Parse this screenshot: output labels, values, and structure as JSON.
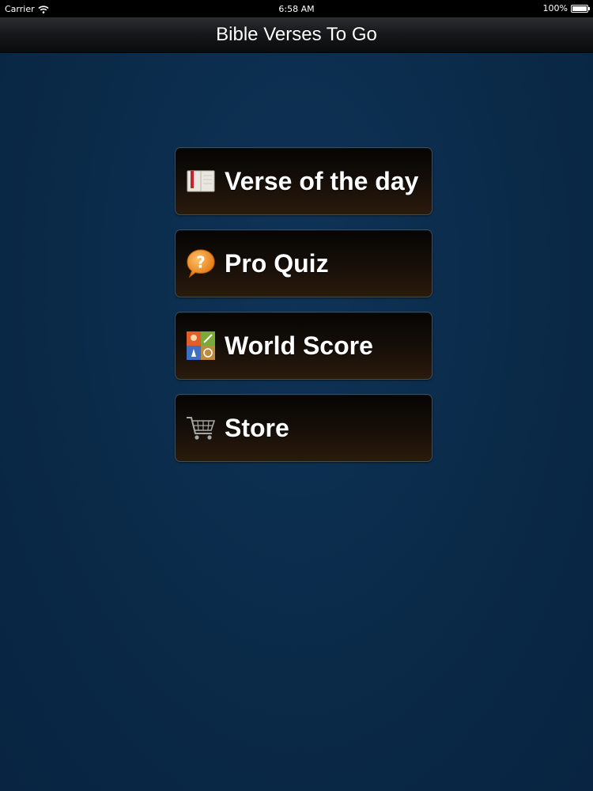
{
  "status_bar": {
    "carrier": "Carrier",
    "time": "6:58 AM",
    "battery": "100%",
    "battery_level": 1.0
  },
  "nav_bar": {
    "title": "Bible Verses To Go"
  },
  "menu": {
    "items": [
      {
        "label": "Verse of the day",
        "icon": "book-icon"
      },
      {
        "label": "Pro Quiz",
        "icon": "question-bubble-icon"
      },
      {
        "label": "World Score",
        "icon": "game-center-icon"
      },
      {
        "label": "Store",
        "icon": "shopping-cart-icon"
      }
    ]
  },
  "colors": {
    "background": "#0b2a47",
    "button_border": "#3b4f63",
    "quiz_orange": "#f28a1e"
  }
}
